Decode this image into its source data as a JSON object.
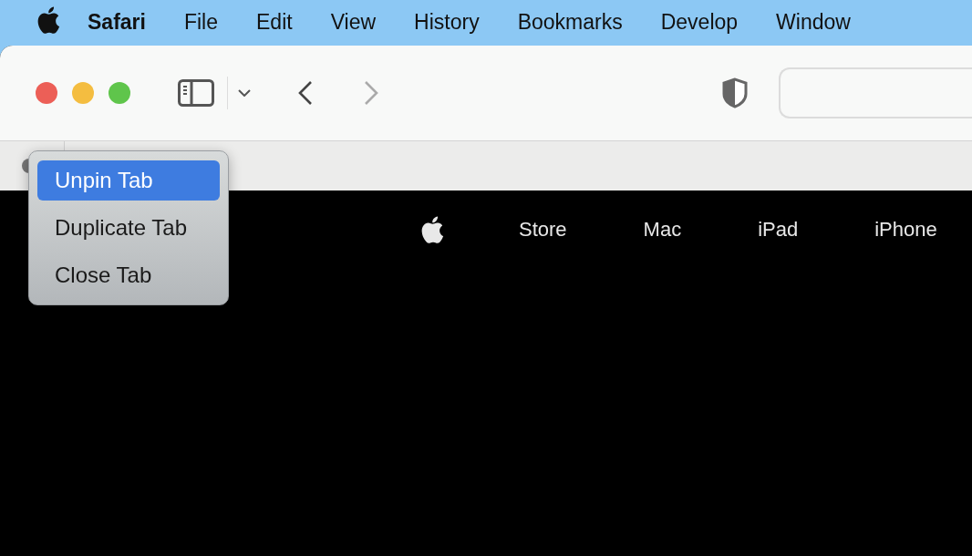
{
  "menu_bar": {
    "app_name": "Safari",
    "items": [
      "File",
      "Edit",
      "View",
      "History",
      "Bookmarks",
      "Develop",
      "Window"
    ]
  },
  "context_menu": {
    "items": [
      {
        "label": "Unpin Tab",
        "selected": true
      },
      {
        "label": "Duplicate Tab",
        "selected": false
      },
      {
        "label": "Close Tab",
        "selected": false
      }
    ]
  },
  "page_nav": {
    "items": [
      "Store",
      "Mac",
      "iPad",
      "iPhone"
    ]
  }
}
